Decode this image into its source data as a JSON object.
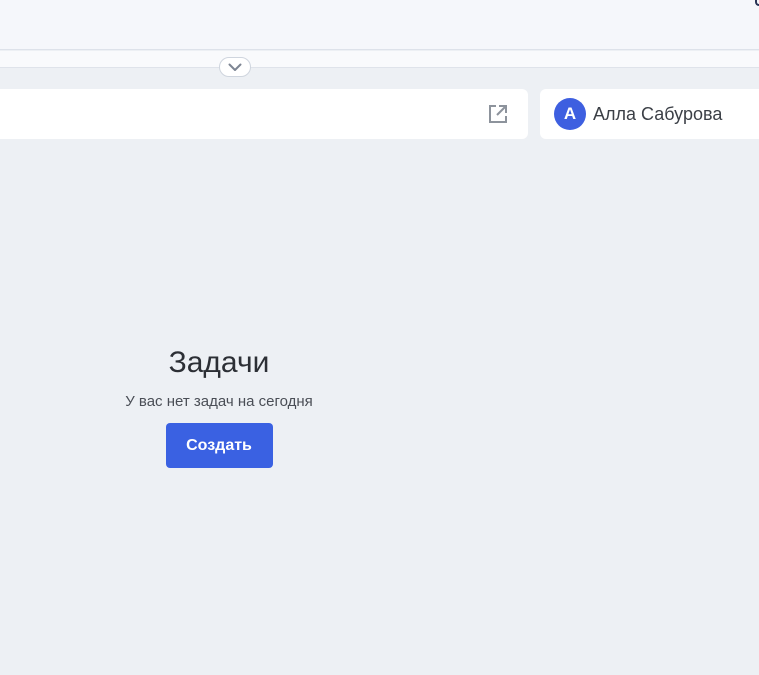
{
  "header": {
    "collapse_icon": "chevron-down-icon"
  },
  "search_panel": {
    "open_icon": "external-link-icon"
  },
  "user": {
    "avatar_initial": "А",
    "name": "Алла Сабурова",
    "avatar_color": "#3e5fe0"
  },
  "tasks": {
    "title": "Задачи",
    "empty_message": "У вас нет задач на сегодня",
    "create_label": "Создать",
    "button_color": "#3a61e2"
  }
}
